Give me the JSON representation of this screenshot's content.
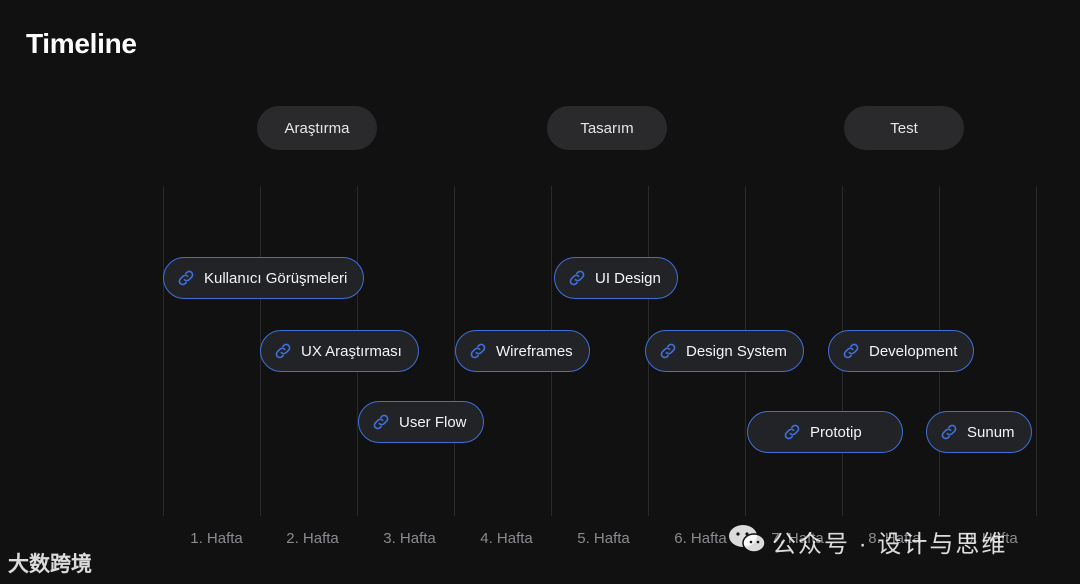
{
  "title": "Timeline",
  "colors": {
    "background": "#111112",
    "accent": "#3f6fd8",
    "pill": "#2a2a2c",
    "task_bg": "#222327"
  },
  "phases": [
    {
      "label": "Araştırma"
    },
    {
      "label": "Tasarım"
    },
    {
      "label": "Test"
    }
  ],
  "weeks": [
    "1. Hafta",
    "2. Hafta",
    "3. Hafta",
    "4. Hafta",
    "5. Hafta",
    "6. Hafta",
    "7. Hafta",
    "8. Hafta",
    "9. Hafta"
  ],
  "tasks": [
    {
      "label": "Kullanıcı Görüşmeleri",
      "icon": "link-icon"
    },
    {
      "label": "UX Araştırması",
      "icon": "link-icon"
    },
    {
      "label": "User Flow",
      "icon": "link-icon"
    },
    {
      "label": "Wireframes",
      "icon": "link-icon"
    },
    {
      "label": "UI Design",
      "icon": "link-icon"
    },
    {
      "label": "Design System",
      "icon": "link-icon"
    },
    {
      "label": "Prototip",
      "icon": "link-icon"
    },
    {
      "label": "Development",
      "icon": "link-icon"
    },
    {
      "label": "Sunum",
      "icon": "link-icon"
    }
  ],
  "watermark": {
    "text": "公众号 · 设计与思维",
    "brand": "大数跨境"
  }
}
